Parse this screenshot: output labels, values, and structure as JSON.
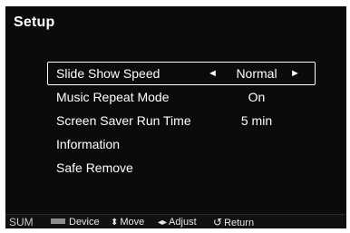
{
  "screen": {
    "title": "Setup"
  },
  "menu": {
    "items": [
      {
        "label": "Slide Show Speed",
        "value": "Normal",
        "selected": true
      },
      {
        "label": "Music Repeat Mode",
        "value": "On",
        "selected": false
      },
      {
        "label": "Screen Saver Run Time",
        "value": "5 min",
        "selected": false
      },
      {
        "label": "Information",
        "value": "",
        "selected": false
      },
      {
        "label": "Safe Remove",
        "value": "",
        "selected": false
      }
    ],
    "arrow_left": "◄",
    "arrow_right": "►"
  },
  "footer": {
    "brand": "SUM",
    "device_label": "Device",
    "move_icon": "⬍",
    "move_label": "Move",
    "adjust_icon": "◂▸",
    "adjust_label": "Adjust",
    "return_icon": "↺",
    "return_label": "Return"
  }
}
